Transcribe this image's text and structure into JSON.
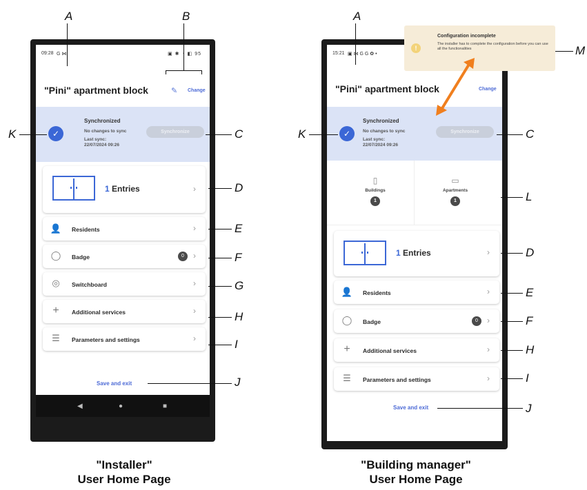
{
  "left": {
    "status_time": "09:28",
    "status_left_icons": "G ⋈",
    "status_right_icons": "▣ ✱ ◔ ◧ 95",
    "title": "\"Pini\" apartment block",
    "change_label": "Change",
    "sync": {
      "title": "Synchronized",
      "no_changes": "No changes to sync",
      "last_sync_label": "Last sync:",
      "last_sync_date": "22/07/2024 09:26",
      "button": "Synchronize"
    },
    "entries": {
      "count": "1",
      "label": "Entries"
    },
    "menu": [
      {
        "label": "Residents",
        "icon": "person-icon"
      },
      {
        "label": "Badge",
        "icon": "badge-icon",
        "count": "0"
      },
      {
        "label": "Switchboard",
        "icon": "switchboard-icon"
      },
      {
        "label": "Additional services",
        "icon": "plus-icon"
      },
      {
        "label": "Parameters and settings",
        "icon": "sliders-icon"
      }
    ],
    "save_exit": "Save and exit",
    "caption_line1": "\"Installer\"",
    "caption_line2": "User Home Page"
  },
  "right": {
    "status_time": "15:21",
    "status_left_icons": "▣ ⋈ G G ✿ •",
    "title": "\"Pini\" apartment block",
    "change_label": "Change",
    "notice": {
      "title": "Configuration incomplete",
      "message": "The installer has to complete the configuration before you can use all the  functionalities"
    },
    "sync": {
      "title": "Synchronized",
      "no_changes": "No changes to sync",
      "last_sync_label": "Last sync:",
      "last_sync_date": "22/07/2024 09:26",
      "button": "Synchronize"
    },
    "stats": [
      {
        "label": "Buildings",
        "count": "1"
      },
      {
        "label": "Apartments",
        "count": "1"
      }
    ],
    "entries": {
      "count": "1",
      "label": "Entries"
    },
    "menu": [
      {
        "label": "Residents",
        "icon": "person-icon"
      },
      {
        "label": "Badge",
        "icon": "badge-icon",
        "count": "0"
      },
      {
        "label": "Additional services",
        "icon": "plus-icon"
      },
      {
        "label": "Parameters and settings",
        "icon": "sliders-icon"
      }
    ],
    "save_exit": "Save and exit",
    "caption_line1": "\"Building manager\"",
    "caption_line2": "User Home Page"
  },
  "callouts": {
    "A": "A",
    "B": "B",
    "C": "C",
    "D": "D",
    "E": "E",
    "F": "F",
    "G": "G",
    "H": "H",
    "I": "I",
    "J": "J",
    "K": "K",
    "L": "L",
    "M": "M"
  },
  "colors": {
    "accent": "#3b67d6",
    "sync_bg": "#dbe3f6",
    "notice_bg": "#f6ecd8",
    "arrow": "#f07f1e"
  }
}
